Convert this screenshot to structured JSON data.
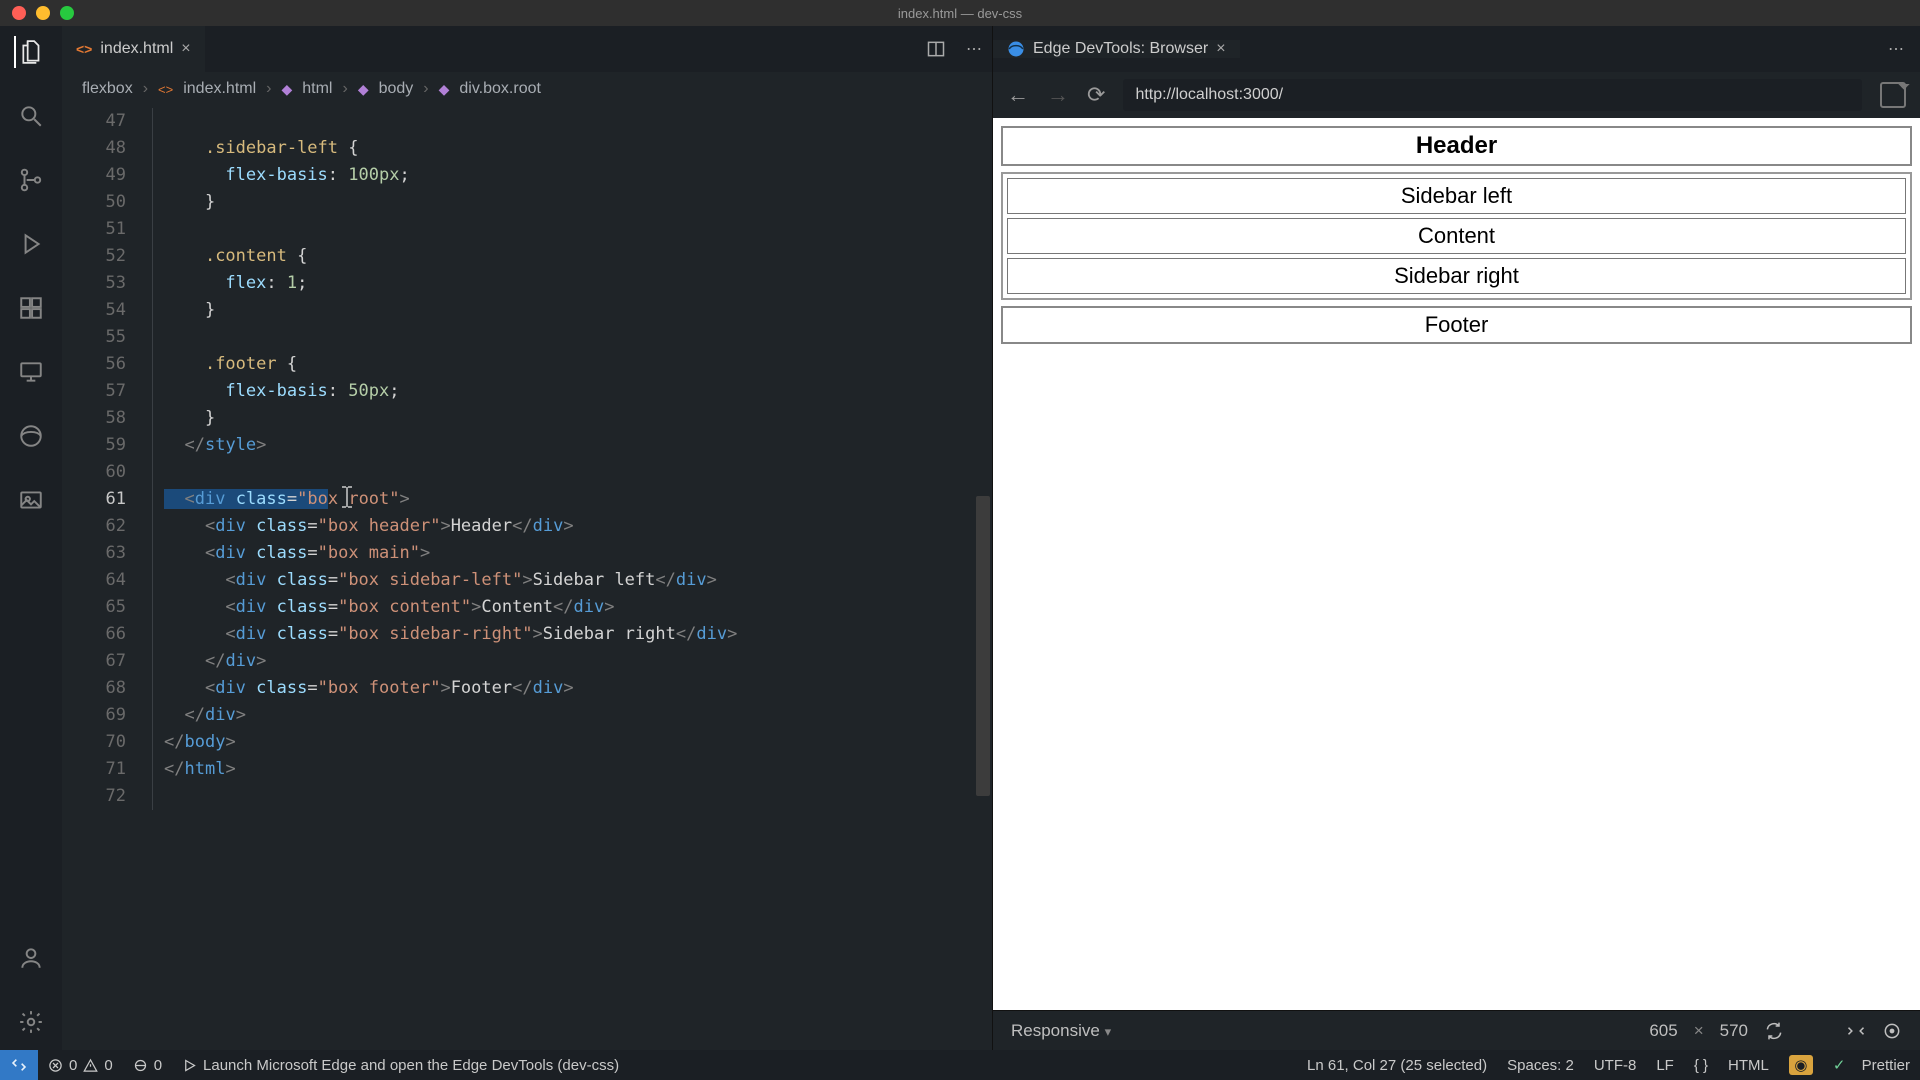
{
  "window": {
    "title": "index.html — dev-css"
  },
  "activity": {
    "icons": [
      "files",
      "search",
      "scm",
      "debug",
      "extensions",
      "remote",
      "edge",
      "image"
    ],
    "bottom": [
      "account",
      "gear"
    ]
  },
  "editorTab": {
    "filename": "index.html"
  },
  "breadcrumbs": {
    "folder": "flexbox",
    "file": "index.html",
    "path": [
      "html",
      "body",
      "div.box.root"
    ]
  },
  "gutter": {
    "start": 47,
    "end": 72,
    "current": 61
  },
  "code": {
    "l47": "",
    "l48_sel": ".sidebar-left",
    "l49_prop": "flex-basis",
    "l49_val": "100px",
    "l52_sel": ".content",
    "l53_prop": "flex",
    "l53_val": "1",
    "l56_sel": ".footer",
    "l57_prop": "flex-basis",
    "l57_val": "50px",
    "l59_close": "style",
    "l61_attr_pre": "bo",
    "l61_attr_post": " root",
    "l62_cls": "box header",
    "l62_txt": "Header",
    "l63_cls": "box main",
    "l64_cls": "box sidebar-left",
    "l64_txt": "Sidebar left",
    "l65_cls": "box content",
    "l65_txt": "Content",
    "l66_cls": "box sidebar-right",
    "l66_txt": "Sidebar right",
    "l68_cls": "box footer",
    "l68_txt": "Footer",
    "l70_close": "body",
    "l71_close": "html",
    "div": "div",
    "class": "class",
    "eq": "=",
    "q": "\""
  },
  "devtools": {
    "tabTitle": "Edge DevTools: Browser",
    "url": "http://localhost:3000/"
  },
  "preview": {
    "header": "Header",
    "sidebarLeft": "Sidebar left",
    "content": "Content",
    "sidebarRight": "Sidebar right",
    "footer": "Footer"
  },
  "devFooter": {
    "mode": "Responsive",
    "w": "605",
    "h": "570"
  },
  "status": {
    "errors": "0",
    "warnings": "0",
    "ports": "0",
    "launch": "Launch Microsoft Edge and open the Edge DevTools (dev-css)",
    "cursor": "Ln 61, Col 27 (25 selected)",
    "spaces": "Spaces: 2",
    "enc": "UTF-8",
    "eol": "LF",
    "lang": "HTML",
    "prettier": "Prettier"
  }
}
